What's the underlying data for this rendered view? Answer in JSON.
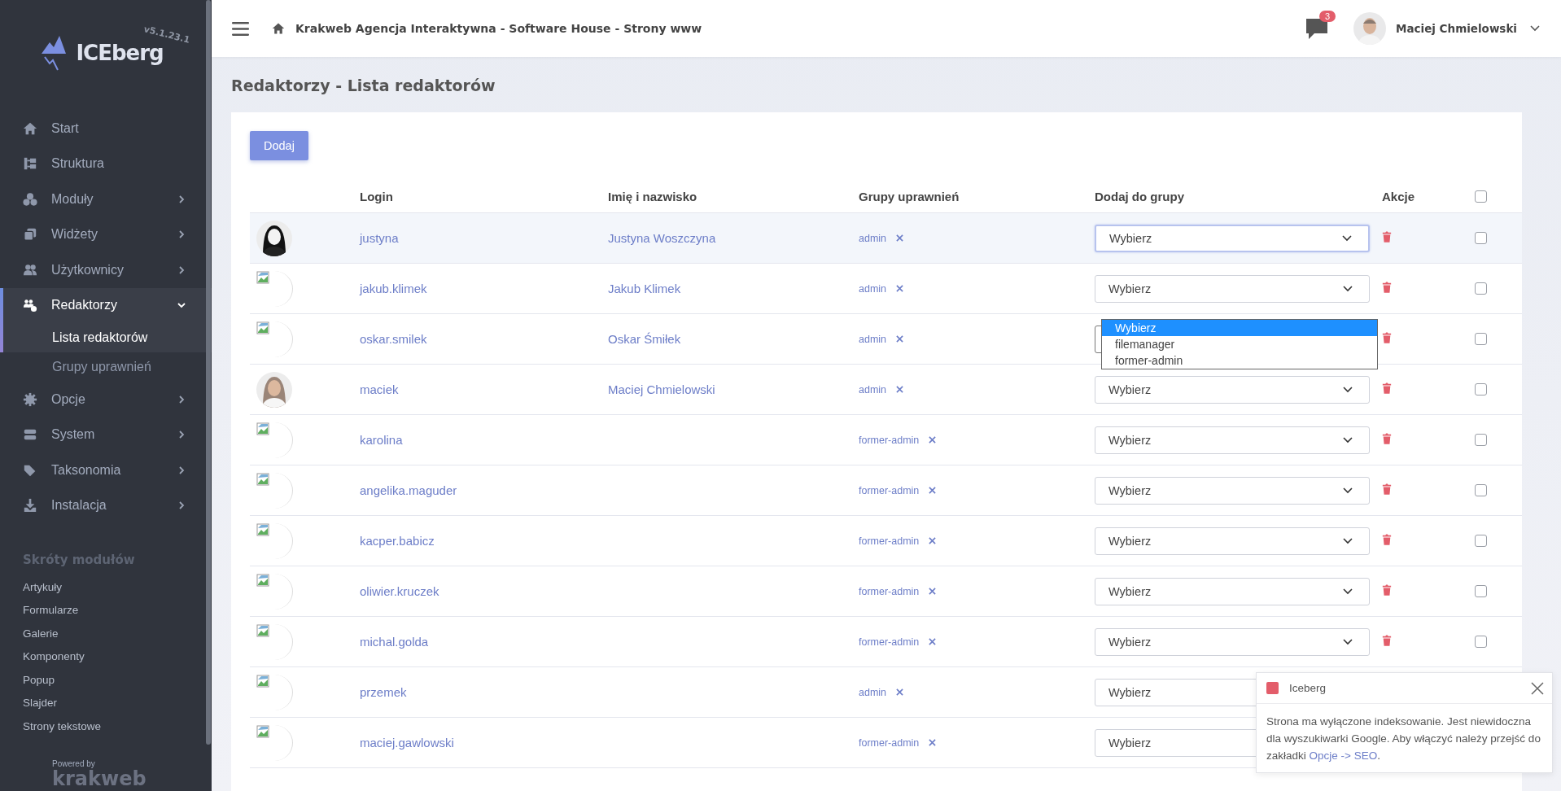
{
  "app": {
    "logo": "ICEberg",
    "version": "v5.1.23.1"
  },
  "sidebar": {
    "items": [
      {
        "label": "Start",
        "has_submenu": false,
        "expanded": false
      },
      {
        "label": "Struktura",
        "has_submenu": false,
        "expanded": false
      },
      {
        "label": "Moduły",
        "has_submenu": true,
        "expanded": false
      },
      {
        "label": "Widżety",
        "has_submenu": true,
        "expanded": false
      },
      {
        "label": "Użytkownicy",
        "has_submenu": true,
        "expanded": false
      },
      {
        "label": "Redaktorzy",
        "has_submenu": true,
        "expanded": true,
        "children": [
          {
            "label": "Lista redaktorów",
            "selected": true
          },
          {
            "label": "Grupy uprawnień",
            "selected": false
          }
        ]
      },
      {
        "label": "Opcje",
        "has_submenu": true,
        "expanded": false
      },
      {
        "label": "System",
        "has_submenu": true,
        "expanded": false
      },
      {
        "label": "Taksonomia",
        "has_submenu": true,
        "expanded": false
      },
      {
        "label": "Instalacja",
        "has_submenu": true,
        "expanded": false
      }
    ],
    "shortcuts_title": "Skróty modułów",
    "shortcuts": [
      "Artykuły",
      "Formularze",
      "Galerie",
      "Komponenty",
      "Popup",
      "Slajder",
      "Strony tekstowe"
    ],
    "powered_by": "Powered by",
    "brand": "krakweb"
  },
  "header": {
    "breadcrumb": "Krakweb Agencja Interaktywna - Software House - Strony www",
    "notifications": "3",
    "user": "Maciej Chmielowski"
  },
  "page_title": "Redaktorzy - Lista redaktorów",
  "add_button": "Dodaj",
  "table": {
    "columns": [
      "Login",
      "Imię i nazwisko",
      "Grupy uprawnień",
      "Dodaj do grupy",
      "Akcje"
    ],
    "select_all_checked": false,
    "rows": [
      {
        "avatar": {
          "kind": "picture"
        },
        "login": "justyna",
        "name": "Justyna Woszczyna",
        "groups": [
          "admin"
        ],
        "select": {
          "value": "Wybierz",
          "focused": true,
          "open": false
        },
        "highlighted": true,
        "checked": false
      },
      {
        "avatar": {
          "kind": "broken"
        },
        "login": "jakub.klimek",
        "name": "Jakub Klimek",
        "groups": [
          "admin"
        ],
        "select": {
          "value": "Wybierz",
          "focused": false,
          "open": false
        },
        "highlighted": false,
        "checked": false
      },
      {
        "avatar": {
          "kind": "broken"
        },
        "login": "oskar.smilek",
        "name": "Oskar Śmiłek",
        "groups": [
          "admin"
        ],
        "select": {
          "focused": false,
          "open": true,
          "options": [
            {
              "label": "Wybierz",
              "selected": true
            },
            {
              "label": "filemanager",
              "selected": false
            },
            {
              "label": "former-admin",
              "selected": false
            }
          ]
        },
        "highlighted": false,
        "checked": false
      },
      {
        "avatar": {
          "kind": "picture"
        },
        "login": "maciek",
        "name": "Maciej Chmielowski",
        "groups": [
          "admin"
        ],
        "select": {
          "value": "Wybierz",
          "focused": false,
          "open": false
        },
        "highlighted": false,
        "checked": false
      },
      {
        "avatar": {
          "kind": "broken"
        },
        "login": "karolina",
        "groups": [
          "former-admin"
        ],
        "select": {
          "value": "Wybierz",
          "focused": false,
          "open": false
        },
        "highlighted": false,
        "checked": false
      },
      {
        "avatar": {
          "kind": "broken"
        },
        "login": "angelika.maguder",
        "groups": [
          "former-admin"
        ],
        "select": {
          "value": "Wybierz",
          "focused": false,
          "open": false
        },
        "highlighted": false,
        "checked": false
      },
      {
        "avatar": {
          "kind": "broken"
        },
        "login": "kacper.babicz",
        "groups": [
          "former-admin"
        ],
        "select": {
          "value": "Wybierz",
          "focused": false,
          "open": false
        },
        "highlighted": false,
        "checked": false
      },
      {
        "avatar": {
          "kind": "broken"
        },
        "login": "oliwier.kruczek",
        "groups": [
          "former-admin"
        ],
        "select": {
          "value": "Wybierz",
          "focused": false,
          "open": false
        },
        "highlighted": false,
        "checked": false
      },
      {
        "avatar": {
          "kind": "broken"
        },
        "login": "michal.golda",
        "groups": [
          "former-admin"
        ],
        "select": {
          "value": "Wybierz",
          "focused": false,
          "open": false
        },
        "highlighted": false,
        "checked": false
      },
      {
        "avatar": {
          "kind": "broken"
        },
        "login": "przemek",
        "groups": [
          "admin"
        ],
        "select": {
          "value": "Wybierz",
          "focused": false,
          "open": false
        },
        "highlighted": false
      },
      {
        "avatar": {
          "kind": "broken"
        },
        "login": "maciej.gawlowski",
        "groups": [
          "former-admin"
        ],
        "select": {
          "value": "Wybierz",
          "focused": false,
          "open": false
        },
        "highlighted": false
      }
    ]
  },
  "notification": {
    "title": "Iceberg",
    "color": "#e35d6a",
    "text": "Strona ma wyłączone indeksowanie. Jest niewidoczna dla wyszukiwarki Google. Aby włączyć należy przejść do zakładki ",
    "link": "Opcje -> SEO",
    "after": "."
  }
}
